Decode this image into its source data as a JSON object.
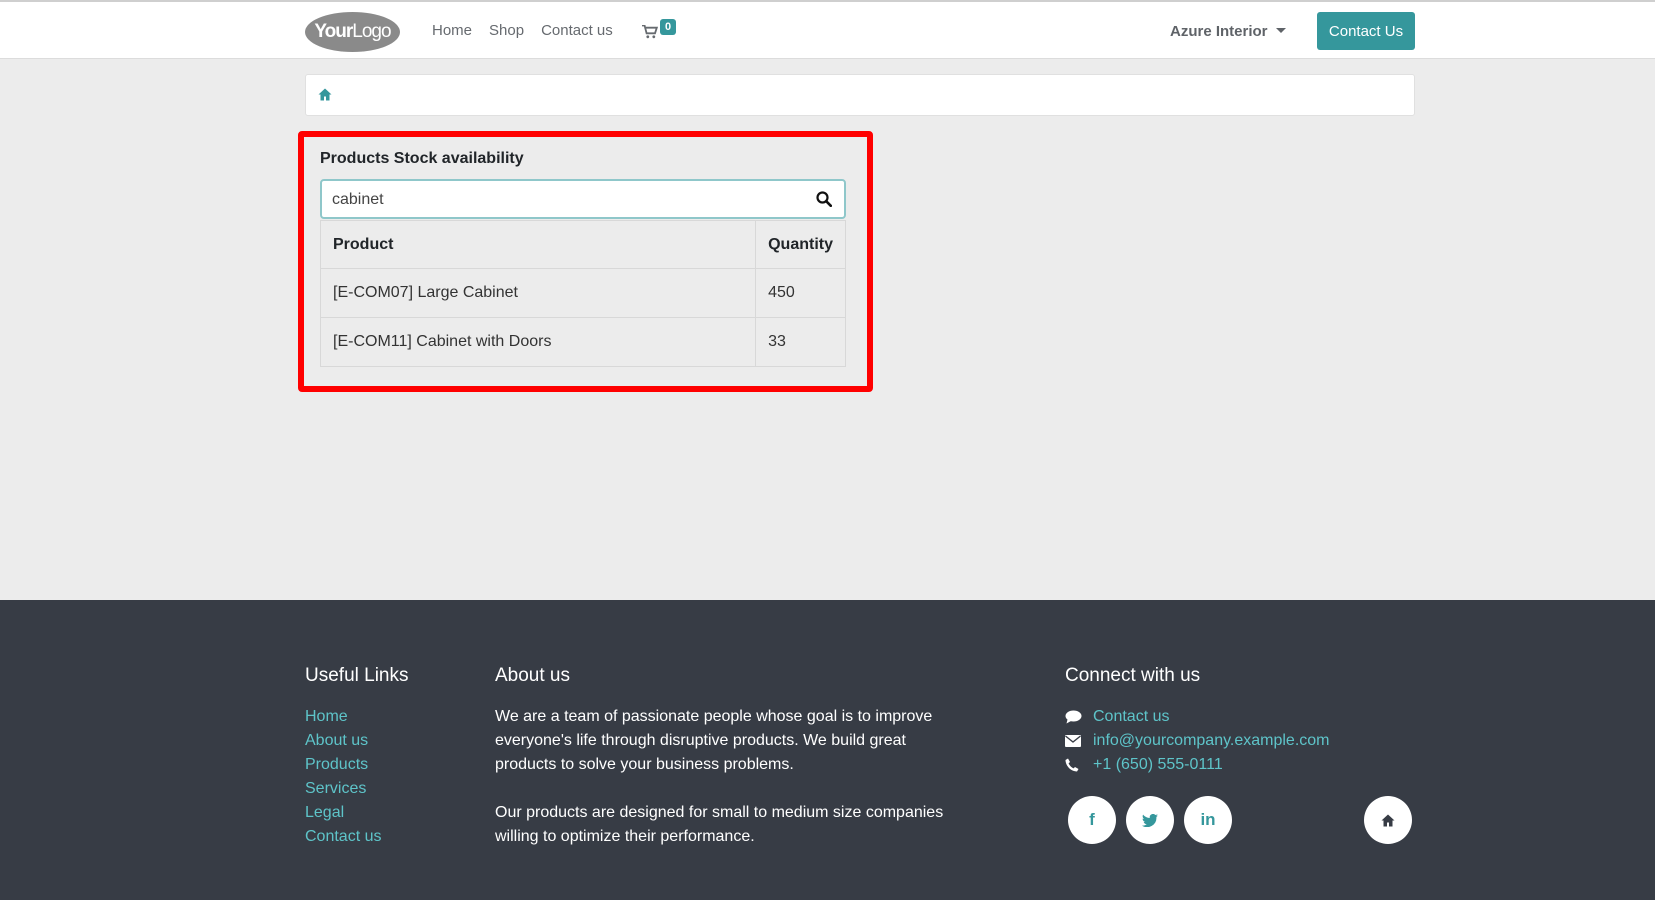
{
  "header": {
    "logo": {
      "bold": "Your",
      "light": "Logo"
    },
    "nav": [
      "Home",
      "Shop",
      "Contact us"
    ],
    "cart_count": "0",
    "user_name": "Azure Interior",
    "contact_button": "Contact Us"
  },
  "widget": {
    "title": "Products Stock availability",
    "search_value": "cabinet",
    "columns": {
      "product": "Product",
      "quantity": "Quantity"
    },
    "rows": [
      {
        "product": "[E-COM07] Large Cabinet",
        "quantity": "450"
      },
      {
        "product": "[E-COM11] Cabinet with Doors",
        "quantity": "33"
      }
    ]
  },
  "footer": {
    "useful_links_title": "Useful Links",
    "useful_links": [
      "Home",
      "About us",
      "Products",
      "Services",
      "Legal",
      "Contact us"
    ],
    "about_title": "About us",
    "about_paragraphs": [
      "We are a team of passionate people whose goal is to improve everyone's life through disruptive products. We build great products to solve your business problems.",
      "Our products are designed for small to medium size companies willing to optimize their performance."
    ],
    "connect_title": "Connect with us",
    "connect": {
      "contact": "Contact us",
      "email": "info@yourcompany.example.com",
      "phone": "+1 (650) 555-0111"
    },
    "social": {
      "facebook": "f",
      "linkedin": "in"
    }
  },
  "colors": {
    "accent": "#35979c",
    "link": "#5ec4c9",
    "footer_bg": "#373c45",
    "highlight": "#ff0000"
  },
  "icons": [
    "cart-icon",
    "home-icon",
    "search-icon",
    "comment-icon",
    "envelope-icon",
    "phone-icon",
    "twitter-icon"
  ]
}
